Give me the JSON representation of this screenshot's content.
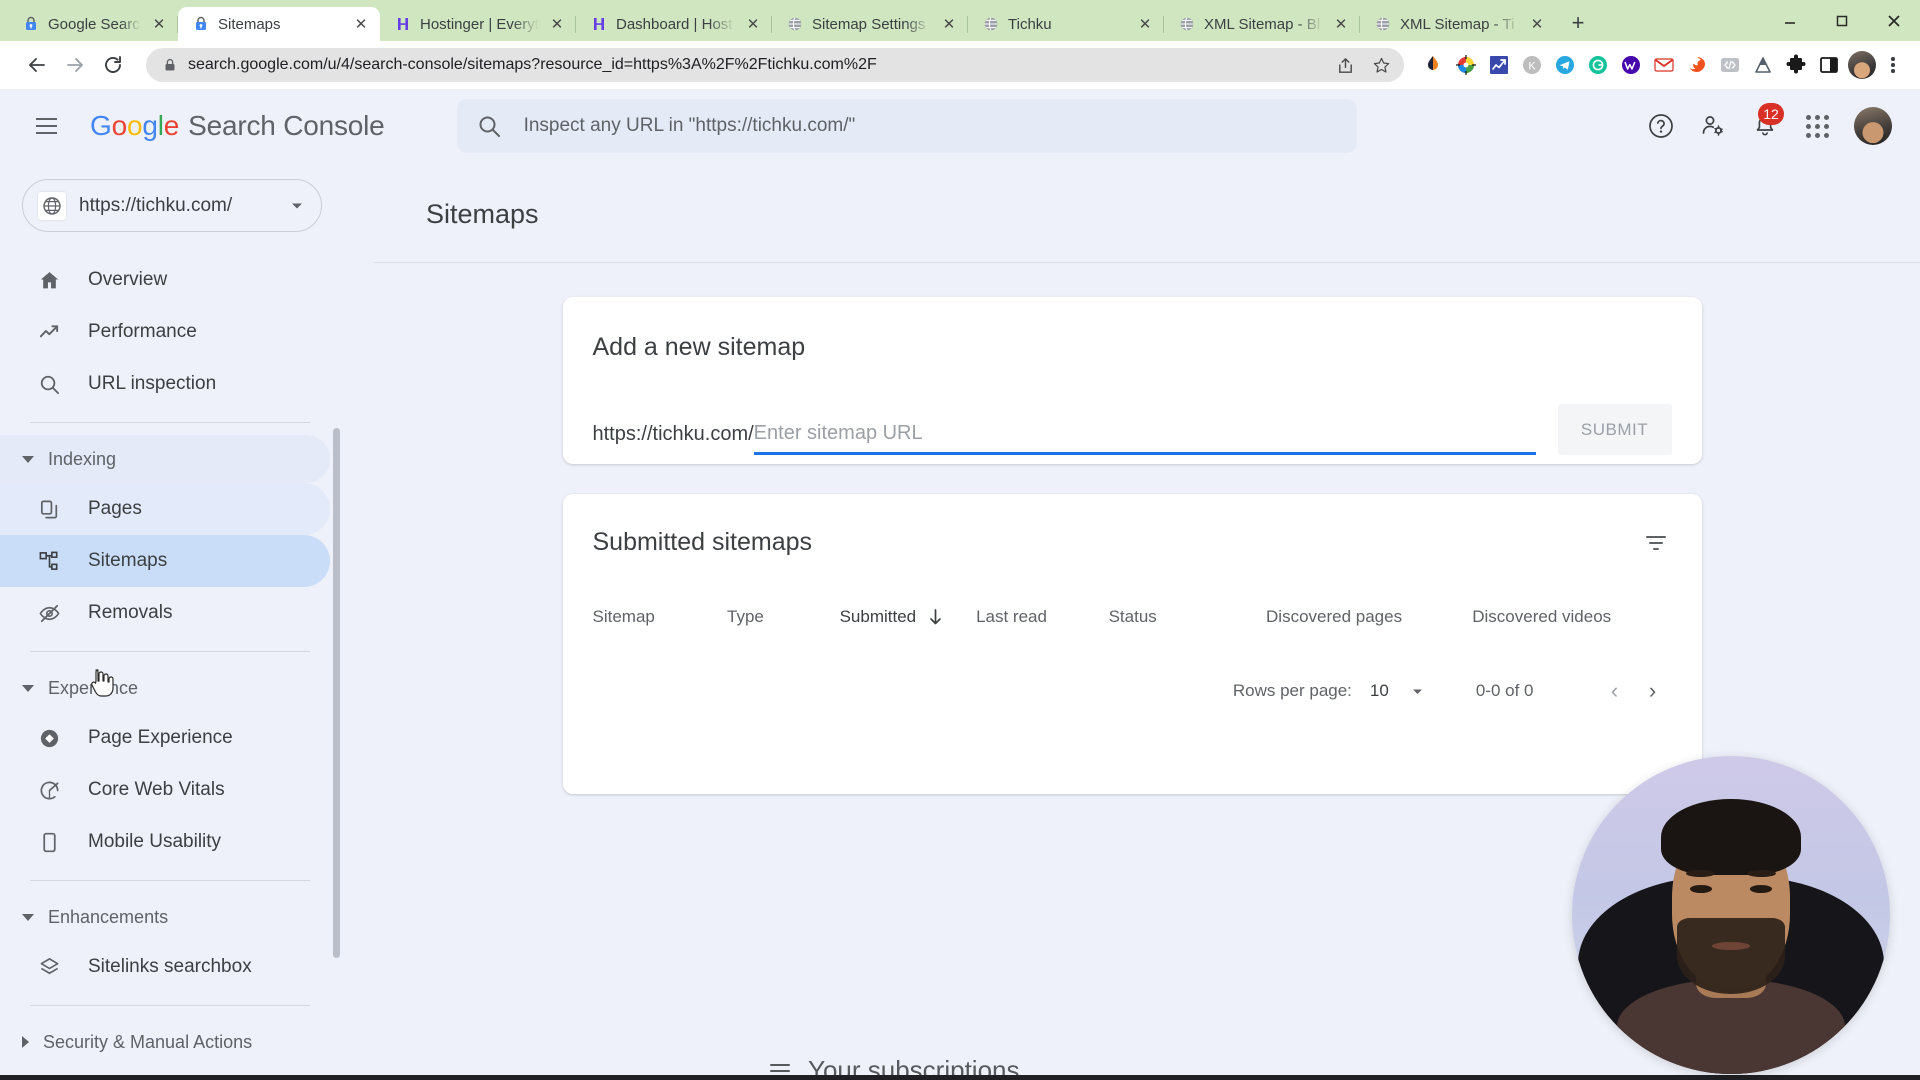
{
  "browser": {
    "tabs": [
      {
        "title": "Google Search Co",
        "favicon": "search-console-icon",
        "active": false
      },
      {
        "title": "Sitemaps",
        "favicon": "search-console-icon",
        "active": true
      },
      {
        "title": "Hostinger | Everyt",
        "favicon": "hostinger-icon",
        "active": false
      },
      {
        "title": "Dashboard | Host",
        "favicon": "hostinger-icon",
        "active": false
      },
      {
        "title": "Sitemap Settings",
        "favicon": "globe-icon",
        "active": false
      },
      {
        "title": "Tichku",
        "favicon": "globe-icon",
        "active": false
      },
      {
        "title": "XML Sitemap - Bl",
        "favicon": "globe-icon",
        "active": false
      },
      {
        "title": "XML Sitemap - Ti",
        "favicon": "globe-icon",
        "active": false
      }
    ],
    "new_tab_label": "+",
    "close_label": "✕",
    "window_controls": {
      "minimize": "—",
      "maximize": "☐",
      "close": "✕"
    },
    "address": {
      "url": "search.google.com/u/4/search-console/sitemaps?resource_id=https%3A%2F%2Ftichku.com%2F",
      "lock_icon": "lock-icon",
      "share_icon": "share-icon",
      "bookmark_icon": "star-icon"
    },
    "extensions": [
      "similarweb-icon",
      "colorzilla-icon",
      "seo-meta-icon",
      "keywords-everywhere-icon",
      "telegram-icon",
      "grammarly-icon",
      "wappalyzer-icon",
      "gmail-icon",
      "firefox-relay-icon",
      "code-icon",
      "ahrefs-icon",
      "puzzle-extensions-icon",
      "sidepanel-icon"
    ],
    "profile_icon": "profile-avatar",
    "menu_icon": "three-dot-menu-icon"
  },
  "app": {
    "logo": {
      "google": "Google",
      "product": "Search Console"
    },
    "menu_icon": "hamburger-menu-icon",
    "search": {
      "placeholder": "Inspect any URL in \"https://tichku.com/\"",
      "icon": "search-icon"
    },
    "header_actions": {
      "help": "help-icon",
      "user_settings": "user-settings-icon",
      "notifications": "notifications-bell-icon",
      "notifications_count": "12",
      "apps": "google-apps-grid-icon",
      "avatar": "account-avatar"
    }
  },
  "sidebar": {
    "property": {
      "label": "https://tichku.com/",
      "icon": "globe-icon",
      "caret": "chevron-down-icon"
    },
    "items": [
      {
        "label": "Overview",
        "icon": "home-icon",
        "state": "normal"
      },
      {
        "label": "Performance",
        "icon": "trending-up-icon",
        "state": "normal"
      },
      {
        "label": "URL inspection",
        "icon": "search-icon",
        "state": "normal"
      }
    ],
    "groups": [
      {
        "label": "Indexing",
        "expanded": true,
        "highlight": true,
        "items": [
          {
            "label": "Pages",
            "icon": "pages-copy-icon",
            "state": "hovered"
          },
          {
            "label": "Sitemaps",
            "icon": "sitemaps-tree-icon",
            "state": "selected"
          },
          {
            "label": "Removals",
            "icon": "eye-off-icon",
            "state": "normal"
          }
        ]
      },
      {
        "label": "Experience",
        "expanded": true,
        "highlight": false,
        "items": [
          {
            "label": "Page Experience",
            "icon": "page-experience-icon",
            "state": "normal"
          },
          {
            "label": "Core Web Vitals",
            "icon": "speedometer-icon",
            "state": "normal"
          },
          {
            "label": "Mobile Usability",
            "icon": "mobile-phone-icon",
            "state": "normal"
          }
        ]
      },
      {
        "label": "Enhancements",
        "expanded": true,
        "highlight": false,
        "items": [
          {
            "label": "Sitelinks searchbox",
            "icon": "layers-icon",
            "state": "normal"
          }
        ]
      },
      {
        "label": "Security & Manual Actions",
        "expanded": false,
        "highlight": false,
        "items": []
      }
    ]
  },
  "main": {
    "page_title": "Sitemaps",
    "add_card": {
      "heading": "Add a new sitemap",
      "url_prefix": "https://tichku.com/",
      "input_value": "",
      "input_placeholder": "Enter sitemap URL",
      "submit_label": "SUBMIT"
    },
    "list_card": {
      "heading": "Submitted sitemaps",
      "filter_icon": "filter-icon",
      "columns": [
        {
          "label": "Sitemap",
          "sorted": false
        },
        {
          "label": "Type",
          "sorted": false
        },
        {
          "label": "Submitted",
          "sorted": true,
          "sort_icon": "arrow-down-icon"
        },
        {
          "label": "Last read",
          "sorted": false
        },
        {
          "label": "Status",
          "sorted": false
        },
        {
          "label": "Discovered pages",
          "sorted": false
        },
        {
          "label": "Discovered videos",
          "sorted": false
        }
      ],
      "rows": [],
      "pagination": {
        "rows_per_page_label": "Rows per page:",
        "rows_per_page_value": "10",
        "rows_per_page_caret": "caret-down-icon",
        "range": "0-0 of 0",
        "prev_icon": "‹",
        "next_icon": "›"
      }
    },
    "bottom_peek": {
      "label": "Your subscriptions",
      "icon": "subscriptions-icon"
    }
  },
  "overlay": {
    "webcam": "webcam-presenter-video"
  }
}
